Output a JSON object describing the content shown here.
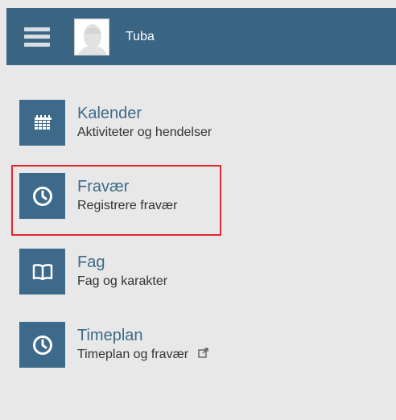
{
  "header": {
    "menu_icon": "hamburger-menu-icon",
    "avatar_icon": "user-avatar-icon",
    "username": "Tuba",
    "background_color": "#3a6583"
  },
  "menu": {
    "items": [
      {
        "icon": "calendar-icon",
        "title": "Kalender",
        "subtitle": "Aktiviteter og hendelser"
      },
      {
        "icon": "clock-icon",
        "title": "Fravær",
        "subtitle": "Registrere fravær"
      },
      {
        "icon": "book-icon",
        "title": "Fag",
        "subtitle": "Fag og karakter"
      },
      {
        "icon": "clock-icon",
        "title": "Timeplan",
        "subtitle": "Timeplan og fravær",
        "trailing_icon": "external-link-icon"
      }
    ]
  },
  "colors": {
    "accent": "#3d6a8a",
    "highlight": "#e4262d",
    "background": "#e8e8e8"
  }
}
